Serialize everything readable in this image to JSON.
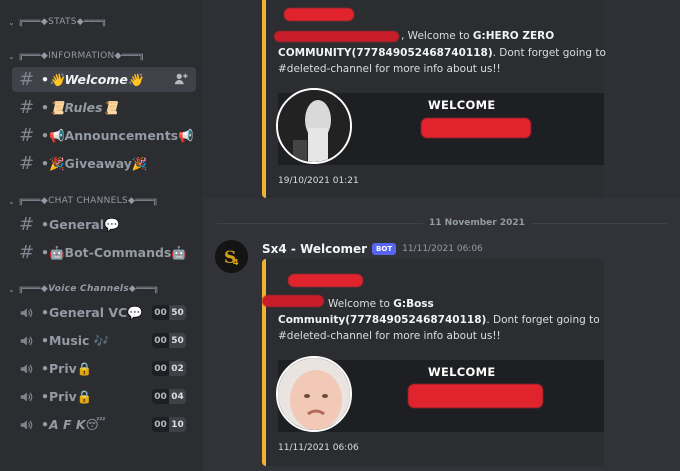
{
  "sidebar": {
    "categories": {
      "stats": "╔═══◆STATS◆═══╗",
      "information": "╔═══◆INFORMATION◆═══╗",
      "chat_channels": "╔═══◆CHAT CHANNELS◆═══╗",
      "voice_channels": "╔═══◆Voice Channels◆═══╗"
    },
    "text_channels": {
      "welcome": "•👋Welcome👋",
      "rules": "•📜Rules📜",
      "announcements": "•📢Announcements📢",
      "giveaway": "•🎉Giveaway🎉",
      "general": "•General💬",
      "bot_commands": "•🤖Bot-Commands🤖"
    },
    "voice_channels": [
      {
        "label": "•General VC💬",
        "count": "00",
        "limit": "50"
      },
      {
        "label": "•Music 🎶",
        "count": "00",
        "limit": "50"
      },
      {
        "label": "•Priv🔒",
        "count": "00",
        "limit": "02"
      },
      {
        "label": "•Priv🔒",
        "count": "00",
        "limit": "04"
      },
      {
        "label": "•A F K😴",
        "count": "00",
        "limit": "10"
      }
    ]
  },
  "messages": {
    "first": {
      "text_line1_suffix": ", Welcome to ",
      "server_name": "G:HERO ZERO",
      "text_line2_bold": "COMMUNITY(777849052468740118)",
      "text_line2_rest": ". Dont forget going to",
      "text_line3": "#deleted-channel for more info about us!!",
      "image_title": "WELCOME",
      "timestamp": "19/10/2021 01:21"
    },
    "date_divider": "11 November 2021",
    "second": {
      "author": "Sx4 - Welcomer",
      "bot_tag": "BOT",
      "time": "11/11/2021 06:06",
      "text_line1_suffix": " Welcome to ",
      "server_name": "G:Boss",
      "text_line2_bold": "Community(777849052468740118)",
      "text_line2_rest": ". Dont forget going to",
      "text_line3": "#deleted-channel for more info about us!!",
      "image_title": "WELCOME",
      "timestamp": "11/11/2021 06:06"
    }
  },
  "colors": {
    "sidebar_bg": "#2b2d31",
    "chat_bg": "#313338",
    "embed_accent": "#f0b232",
    "redaction": "#e0232d",
    "bot_tag": "#5865f2"
  },
  "icons": [
    "hashtag-icon",
    "speaker-icon",
    "add-member-icon",
    "chevron-down-icon",
    "bot-avatar-icon"
  ]
}
